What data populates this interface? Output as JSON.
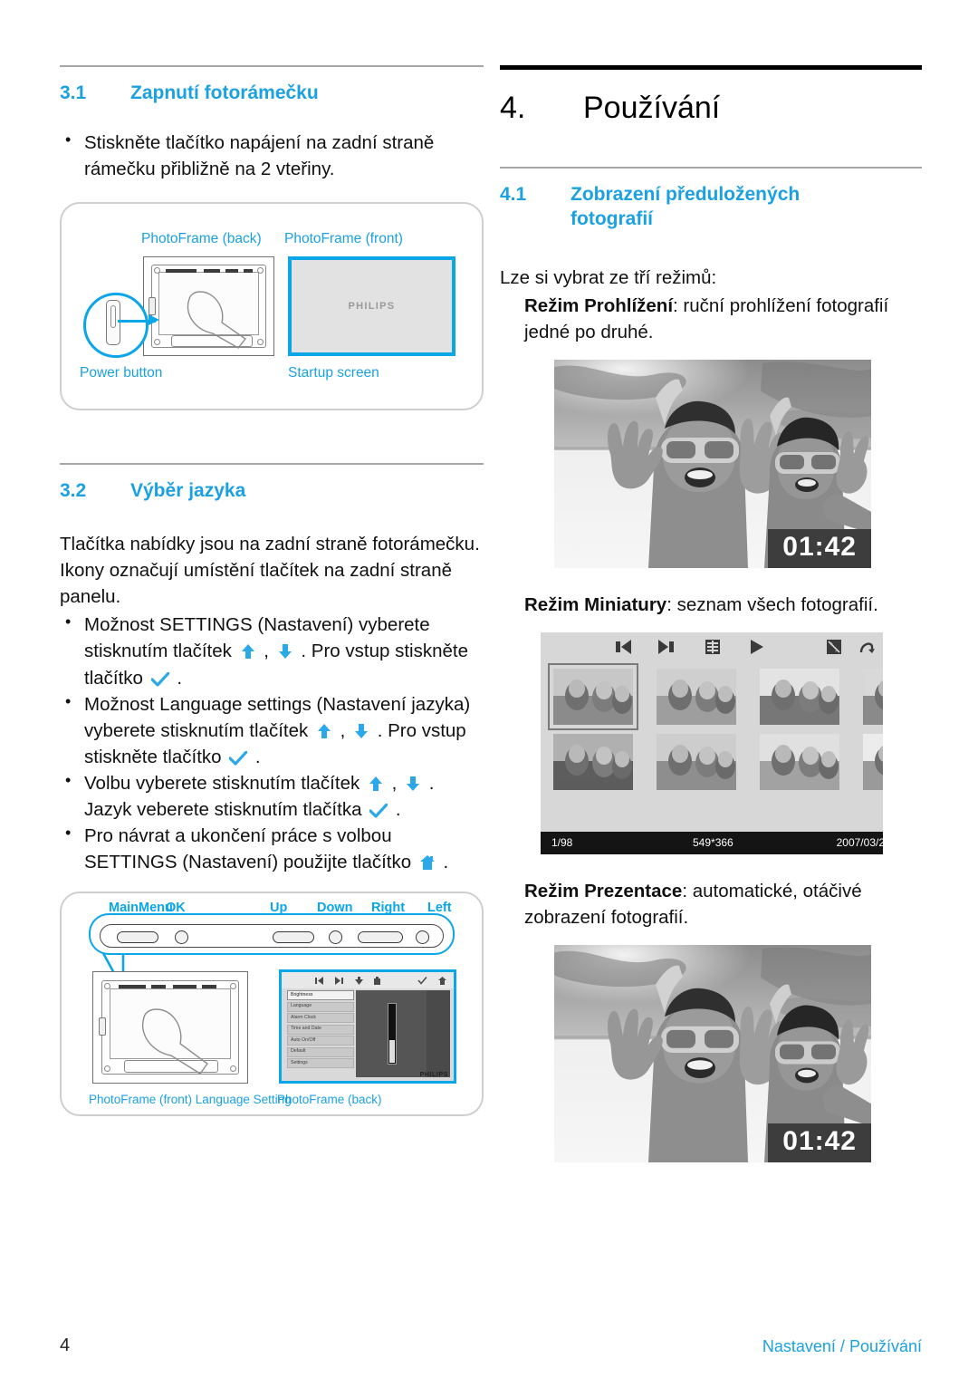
{
  "colors": {
    "accent": "#1ba1e2",
    "accent_art": "#0aa6e8",
    "rule_gray": "#a6a6a6",
    "rule_black": "#000000"
  },
  "left_column": {
    "section_31": {
      "number": "3.1",
      "title": "Zapnutí fotorámečku",
      "bullets": [
        "Stiskněte tlačítko napájení na zadní straně rámečku přibližně na 2 vteřiny."
      ]
    },
    "figure_1": {
      "caption_top_left": "PhotoFrame (back)",
      "caption_top_right": "PhotoFrame (front)",
      "caption_bottom_left": "Power button",
      "caption_bottom_right": "Startup screen",
      "screen_logo": "PHILIPS"
    },
    "section_32": {
      "number": "3.2",
      "title": "Výběr jazyka",
      "intro": "Tlačítka nabídky jsou na zadní straně fotorámečku. Ikony označují umístění tlačítek na zadní straně panelu.",
      "bullets": [
        {
          "parts": [
            {
              "t": "text",
              "v": "Možnost SETTINGS (Nastavení) vyberete stisknutím tlačítek "
            },
            {
              "t": "icon",
              "v": "up-arrow-icon"
            },
            {
              "t": "text",
              "v": " , "
            },
            {
              "t": "icon",
              "v": "down-arrow-icon"
            },
            {
              "t": "text",
              "v": " . Pro vstup stiskněte tlačítko "
            },
            {
              "t": "icon",
              "v": "check-icon"
            },
            {
              "t": "text",
              "v": " ."
            }
          ]
        },
        {
          "parts": [
            {
              "t": "text",
              "v": "Možnost Language settings (Nastavení jazyka) vyberete stisknutím tlačítek "
            },
            {
              "t": "icon",
              "v": "up-arrow-icon"
            },
            {
              "t": "text",
              "v": " , "
            },
            {
              "t": "icon",
              "v": "down-arrow-icon"
            },
            {
              "t": "text",
              "v": " . Pro vstup stiskněte tlačítko "
            },
            {
              "t": "icon",
              "v": "check-icon"
            },
            {
              "t": "text",
              "v": " ."
            }
          ]
        },
        {
          "parts": [
            {
              "t": "text",
              "v": "Volbu vyberete stisknutím tlačítek "
            },
            {
              "t": "icon",
              "v": "up-arrow-icon"
            },
            {
              "t": "text",
              "v": " , "
            },
            {
              "t": "icon",
              "v": "down-arrow-icon"
            },
            {
              "t": "text",
              "v": " . Jazyk veberete stisknutím tlačítka "
            },
            {
              "t": "icon",
              "v": "check-icon"
            },
            {
              "t": "text",
              "v": " ."
            }
          ]
        },
        {
          "parts": [
            {
              "t": "text",
              "v": "Pro návrat a ukončení práce s volbou SETTINGS (Nastavení) použijte tlačítko "
            },
            {
              "t": "icon",
              "v": "home-icon"
            },
            {
              "t": "text",
              "v": " ."
            }
          ]
        }
      ]
    },
    "figure_2": {
      "button_labels": [
        "MainMenu",
        "OK",
        "Up",
        "Down",
        "Right",
        "Left"
      ],
      "caption_left": "PhotoFrame (front) Language Setting",
      "caption_right": "PhotoFrame (back)",
      "menu_items": [
        "Brightness",
        "Language",
        "Alarm Clock",
        "Time and Date",
        "Auto On/Off",
        "Default",
        "Settings"
      ],
      "selected_menu_item": "Brightness",
      "screen_logo": "PHILIPS"
    }
  },
  "right_column": {
    "chapter": {
      "number": "4.",
      "title": "Používání"
    },
    "section_41": {
      "number": "4.1",
      "title": "Zobrazení předuložených fotografií"
    },
    "intro": "Lze si vybrat ze tří režimů:",
    "modes": [
      {
        "name": "Režim Prohlížení",
        "desc": ": ruční prohlížení fotografií jedné po druhé."
      },
      {
        "name": "Režim Miniatury",
        "desc": ": seznam všech fotografií."
      },
      {
        "name": "Režim Prezentace",
        "desc": ": automatické, otáčivé zobrazení fotografií."
      }
    ],
    "photo_browse": {
      "timer": "01:42"
    },
    "thumbnail_screen": {
      "toolbar_icons": [
        "previous-icon",
        "next-icon",
        "thumbnail-grid-icon",
        "play-icon",
        "zoom-icon",
        "back-icon"
      ],
      "status_index": "1/98",
      "status_resolution": "549*366",
      "status_date": "2007/03/2"
    },
    "photo_slideshow": {
      "timer": "01:42"
    }
  },
  "footer": {
    "page_number": "4",
    "text": "Nastavení / Používání"
  }
}
